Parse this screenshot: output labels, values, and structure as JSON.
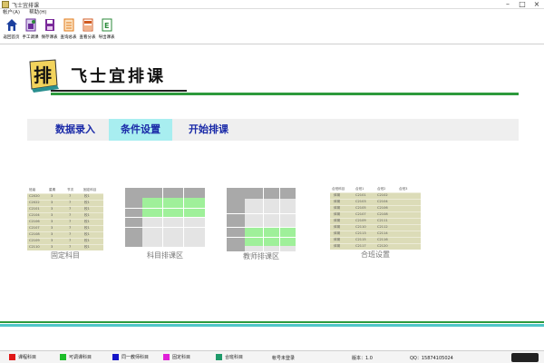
{
  "window": {
    "title": "飞士宜排课"
  },
  "menu": [
    "帐户(A)",
    "帮助(H)"
  ],
  "toolbar": [
    {
      "label": "返回首页",
      "icon": "home-icon",
      "color": "#1b3f9e"
    },
    {
      "label": "手工调课",
      "icon": "manual-adjust-icon",
      "color": "#6a2c9a"
    },
    {
      "label": "保存课表",
      "icon": "save-icon",
      "color": "#7a2a9a"
    },
    {
      "label": "查询总表",
      "icon": "query-table-icon",
      "color": "#e07a1a"
    },
    {
      "label": "查看分表",
      "icon": "sub-table-icon",
      "color": "#d05a20"
    },
    {
      "label": "导出课表",
      "icon": "export-icon",
      "color": "#2b8a3a"
    }
  ],
  "brand": {
    "title": "飞士宜排课",
    "logo_char": "排"
  },
  "tabs": [
    {
      "label": "数据录入",
      "active": false
    },
    {
      "label": "条件设置",
      "active": true
    },
    {
      "label": "开始排课",
      "active": false
    }
  ],
  "cards": [
    {
      "caption": "固定科目"
    },
    {
      "caption": "科目排课区"
    },
    {
      "caption": "教师排课区"
    },
    {
      "caption": "合班设置"
    }
  ],
  "preview_fixed": {
    "headers": [
      "班级",
      "星期",
      "节次",
      "固定科目"
    ],
    "rows": [
      [
        "C2020",
        "3",
        "7",
        "校1"
      ],
      [
        "C2022",
        "3",
        "7",
        "校1"
      ],
      [
        "C2101",
        "3",
        "7",
        "校1"
      ],
      [
        "C2104",
        "3",
        "7",
        "校1"
      ],
      [
        "C2106",
        "3",
        "7",
        "校1"
      ],
      [
        "C2107",
        "3",
        "7",
        "校1"
      ],
      [
        "C2108",
        "3",
        "7",
        "校1"
      ],
      [
        "C2109",
        "3",
        "7",
        "校1"
      ],
      [
        "C2110",
        "3",
        "7",
        "校1"
      ]
    ]
  },
  "preview_merge": {
    "headers": [
      "合班科目",
      "合班1",
      "合班2",
      "合班3"
    ],
    "rows": [
      [
        "体育",
        "C2101",
        "C2102"
      ],
      [
        "体育",
        "C2103",
        "C2104"
      ],
      [
        "体育",
        "C2105",
        "C2106"
      ],
      [
        "体育",
        "C2107",
        "C2108"
      ],
      [
        "体育",
        "C2109",
        "C2111"
      ],
      [
        "体育",
        "C2110",
        "C2112"
      ],
      [
        "体育",
        "C2113",
        "C2114"
      ],
      [
        "体育",
        "C2115",
        "C2116"
      ],
      [
        "体育",
        "C2117",
        "C2120"
      ]
    ]
  },
  "statusbar": {
    "legend": [
      {
        "label": "课程科目",
        "color": "#e01818"
      },
      {
        "label": "可调课科目",
        "color": "#1dbd2a"
      },
      {
        "label": "同一教师科目",
        "color": "#1616c8"
      },
      {
        "label": "固定科目",
        "color": "#e020d8"
      },
      {
        "label": "合班科目",
        "color": "#1e9a6a"
      }
    ],
    "login_status": "帐号未登录",
    "version": "版本：1.0",
    "qq": "QQ：15874105024"
  },
  "colors": {
    "accent_green": "#2d9a3c",
    "accent_cyan": "#4fc6c8",
    "tab_text": "#1a2aa8",
    "tab_active_bg": "#a8eef0"
  }
}
